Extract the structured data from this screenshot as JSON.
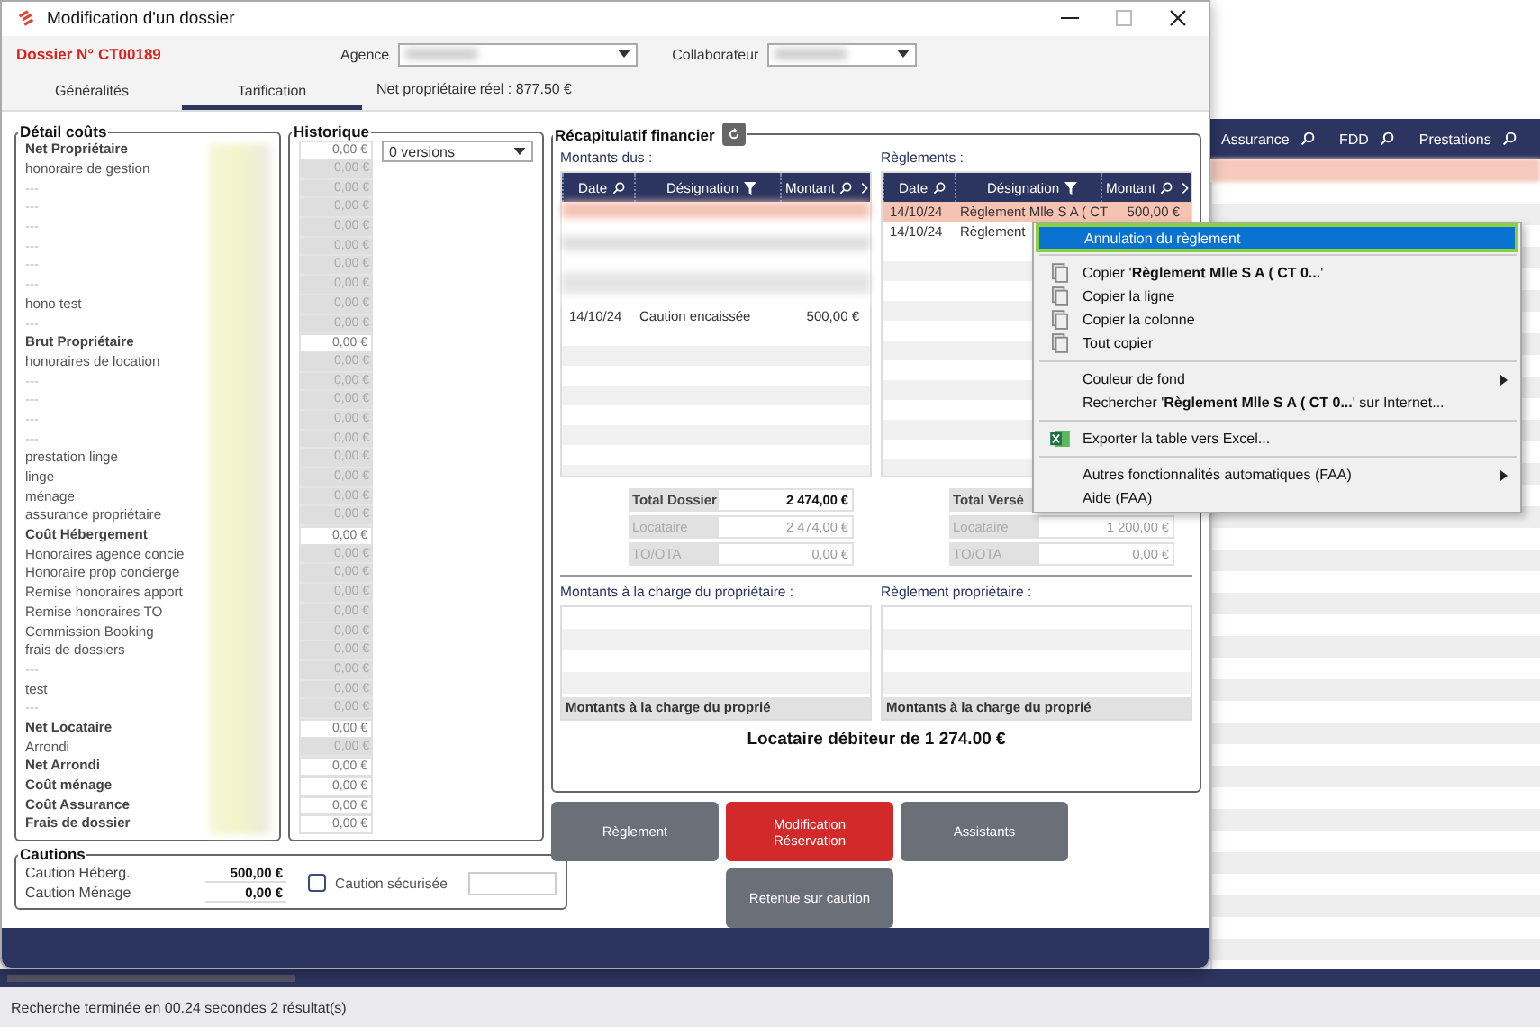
{
  "window": {
    "title": "Modification d'un dossier"
  },
  "header": {
    "dossier": "Dossier N° CT00189",
    "agence_label": "Agence",
    "collaborateur_label": "Collaborateur"
  },
  "tabs": [
    {
      "label": "Généralités",
      "selected": false
    },
    {
      "label": "Tarification",
      "selected": true
    }
  ],
  "net_reel": "Net propriétaire réel : 877.50 €",
  "detail_couts": {
    "title": "Détail coûts",
    "rows": [
      {
        "label": "Net Propriétaire",
        "kind": "total"
      },
      {
        "label": "honoraire de gestion",
        "kind": "line"
      },
      {
        "label": "---",
        "kind": "empty"
      },
      {
        "label": "---",
        "kind": "empty"
      },
      {
        "label": "---",
        "kind": "empty"
      },
      {
        "label": "---",
        "kind": "empty"
      },
      {
        "label": "---",
        "kind": "empty"
      },
      {
        "label": "---",
        "kind": "empty"
      },
      {
        "label": "hono test",
        "kind": "line"
      },
      {
        "label": "---",
        "kind": "empty"
      },
      {
        "label": "Brut Propriétaire",
        "kind": "total"
      },
      {
        "label": "honoraires  de location",
        "kind": "line"
      },
      {
        "label": "---",
        "kind": "empty"
      },
      {
        "label": "---",
        "kind": "empty"
      },
      {
        "label": "---",
        "kind": "empty"
      },
      {
        "label": "---",
        "kind": "empty"
      },
      {
        "label": "prestation linge",
        "kind": "line"
      },
      {
        "label": "linge",
        "kind": "line"
      },
      {
        "label": "ménage",
        "kind": "line"
      },
      {
        "label": "assurance propriétaire",
        "kind": "line"
      },
      {
        "label": "Coût Hébergement",
        "kind": "total"
      },
      {
        "label": "Honoraires agence concie",
        "kind": "line"
      },
      {
        "label": "Honoraire prop concierge",
        "kind": "line"
      },
      {
        "label": "Remise honoraires apport",
        "kind": "line"
      },
      {
        "label": "Remise honoraires TO",
        "kind": "line"
      },
      {
        "label": "Commission Booking",
        "kind": "line"
      },
      {
        "label": "frais de dossiers",
        "kind": "line"
      },
      {
        "label": "---",
        "kind": "empty"
      },
      {
        "label": "test",
        "kind": "line"
      },
      {
        "label": "---",
        "kind": "empty"
      },
      {
        "label": "Net Locataire",
        "kind": "total"
      },
      {
        "label": "Arrondi",
        "kind": "line"
      },
      {
        "label": "Net Arrondi",
        "kind": "total"
      },
      {
        "label": "Coût ménage",
        "kind": "total"
      },
      {
        "label": "Coût Assurance",
        "kind": "total"
      },
      {
        "label": "Frais de dossier",
        "kind": "total"
      }
    ]
  },
  "historique": {
    "title": "Historique",
    "versions": "0 versions",
    "values": [
      {
        "value": "0,00 €",
        "disabled": false
      },
      {
        "value": "0,00 €",
        "disabled": true
      },
      {
        "value": "0,00 €",
        "disabled": true
      },
      {
        "value": "0,00 €",
        "disabled": true
      },
      {
        "value": "0,00 €",
        "disabled": true
      },
      {
        "value": "0,00 €",
        "disabled": true
      },
      {
        "value": "0,00 €",
        "disabled": true
      },
      {
        "value": "0,00 €",
        "disabled": true
      },
      {
        "value": "0,00 €",
        "disabled": true
      },
      {
        "value": "0,00 €",
        "disabled": true
      },
      {
        "value": "0,00 €",
        "disabled": false
      },
      {
        "value": "0,00 €",
        "disabled": true
      },
      {
        "value": "0,00 €",
        "disabled": true
      },
      {
        "value": "0,00 €",
        "disabled": true
      },
      {
        "value": "0,00 €",
        "disabled": true
      },
      {
        "value": "0,00 €",
        "disabled": true
      },
      {
        "value": "0,00 €",
        "disabled": true
      },
      {
        "value": "0,00 €",
        "disabled": true
      },
      {
        "value": "0,00 €",
        "disabled": true
      },
      {
        "value": "0,00 €",
        "disabled": true
      },
      {
        "value": "0,00 €",
        "disabled": false
      },
      {
        "value": "0,00 €",
        "disabled": true
      },
      {
        "value": "0,00 €",
        "disabled": true
      },
      {
        "value": "0,00 €",
        "disabled": true
      },
      {
        "value": "0,00 €",
        "disabled": true
      },
      {
        "value": "0,00 €",
        "disabled": true
      },
      {
        "value": "0,00 €",
        "disabled": true
      },
      {
        "value": "0,00 €",
        "disabled": true
      },
      {
        "value": "0,00 €",
        "disabled": true
      },
      {
        "value": "0,00 €",
        "disabled": true
      },
      {
        "value": "0,00 €",
        "disabled": false
      },
      {
        "value": "0,00 €",
        "disabled": true
      },
      {
        "value": "0,00 €",
        "disabled": false
      },
      {
        "value": "0,00 €",
        "disabled": false
      },
      {
        "value": "0,00 €",
        "disabled": false
      },
      {
        "value": "0,00 €",
        "disabled": false
      }
    ]
  },
  "cautions": {
    "title": "Cautions",
    "rows": [
      {
        "label": "Caution Héberg.",
        "value": "500,00 €"
      },
      {
        "label": "Caution Ménage",
        "value": "0,00 €"
      }
    ],
    "checkbox": {
      "label": "Caution sécurisée",
      "checked": false
    }
  },
  "recap": {
    "title": "Récapitulatif financier",
    "montants_dus": {
      "title": "Montants dus :",
      "columns": [
        {
          "label": "Date"
        },
        {
          "label": "Désignation"
        },
        {
          "label": "Montant"
        }
      ],
      "rows": [
        {
          "cells": [
            "14/10/24",
            "Caution encaissée",
            "500,00 €"
          ],
          "selected": false
        }
      ]
    },
    "reglements": {
      "title": "Règlements :",
      "columns": [
        {
          "label": "Date"
        },
        {
          "label": "Désignation"
        },
        {
          "label": "Montant"
        }
      ],
      "rows": [
        {
          "cells": [
            "14/10/24",
            "Règlement Mlle S A ( CT",
            "500,00 €"
          ],
          "selected": true
        },
        {
          "cells": [
            "14/10/24",
            "Règlement"
          ],
          "selected": false
        }
      ]
    },
    "totals_left": [
      {
        "label": "Total Dossier",
        "value": "2 474,00 €",
        "kind": "total"
      },
      {
        "label": "Locataire",
        "value": "2 474,00 €",
        "kind": "sub"
      },
      {
        "label": "TO/OTA",
        "value": "0,00 €",
        "kind": "sub"
      }
    ],
    "totals_right": [
      {
        "label": "Total Versé",
        "kind": "total"
      },
      {
        "label": "Locataire",
        "value": "1 200,00 €",
        "kind": "sub"
      },
      {
        "label": "TO/OTA",
        "value": "0,00 €",
        "kind": "sub"
      }
    ],
    "charge_proprietaire": {
      "title": "Montants à la charge du propriétaire :",
      "footer": "Montants à la charge du proprié"
    },
    "reglement_proprietaire": {
      "title": "Règlement propriétaire :",
      "footer": "Montants à la charge du proprié"
    },
    "balance": "Locataire débiteur de 1 274.00 €"
  },
  "buttons": [
    {
      "label": "Règlement",
      "kind": "secondary"
    },
    {
      "label": "Modification Réservation",
      "kind": "primary"
    },
    {
      "label": "Assistants",
      "kind": "secondary"
    },
    {
      "label": "Retenue sur caution",
      "kind": "secondary"
    }
  ],
  "background_grid": {
    "columns": [
      {
        "label": "Assurance"
      },
      {
        "label": "FDD"
      },
      {
        "label": "Prestations"
      }
    ]
  },
  "context_menu": [
    {
      "kind": "item",
      "label": "Annulation du règlement",
      "selected": true,
      "submenu": false
    },
    {
      "kind": "separator"
    },
    {
      "kind": "copy",
      "label": "Copier '**Règlement Mlle S A ( CT 0...**'",
      "selected": false,
      "submenu": false
    },
    {
      "kind": "copy",
      "label": "Copier la ligne",
      "selected": false,
      "submenu": false
    },
    {
      "kind": "copy",
      "label": "Copier la colonne",
      "selected": false,
      "submenu": false
    },
    {
      "kind": "copy",
      "label": "Tout copier",
      "selected": false,
      "submenu": false
    },
    {
      "kind": "separator"
    },
    {
      "kind": "item",
      "label": "Couleur de fond",
      "selected": false,
      "submenu": true
    },
    {
      "kind": "item",
      "label": "Rechercher '**Règlement Mlle S A ( CT 0...**' sur Internet...",
      "selected": false,
      "submenu": false
    },
    {
      "kind": "separator"
    },
    {
      "kind": "export",
      "label": "Exporter la table vers Excel...",
      "selected": false,
      "submenu": false
    },
    {
      "kind": "separator"
    },
    {
      "kind": "item",
      "label": "Autres fonctionnalités automatiques (FAA)",
      "selected": false,
      "submenu": true
    },
    {
      "kind": "item",
      "label": "Aide (FAA)",
      "selected": false,
      "submenu": false
    }
  ],
  "status_bar": "Recherche terminée en 00.24 secondes 2 résultat(s)"
}
